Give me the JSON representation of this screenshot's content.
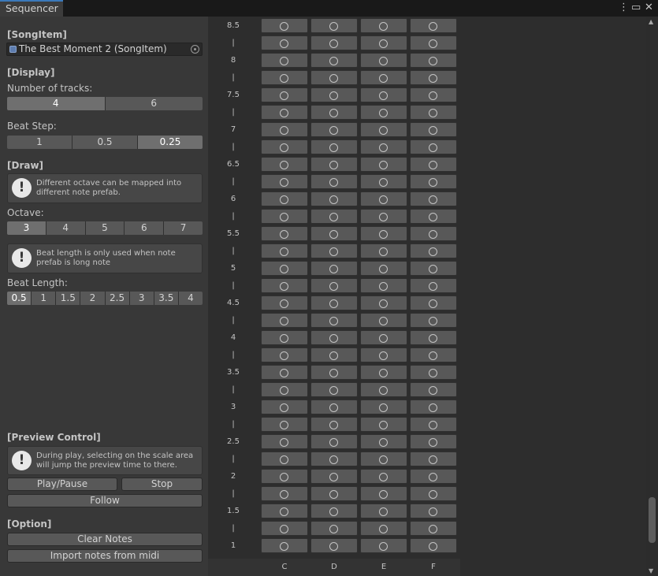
{
  "window": {
    "tab_title": "Sequencer",
    "menu_icon": "kebab-menu-icon",
    "maximize_icon": "maximize-icon",
    "close_icon": "close-icon"
  },
  "song_item": {
    "header": "[SongItem]",
    "value": "The Best Moment 2 (SongItem)"
  },
  "display": {
    "header": "[Display]",
    "tracks_label": "Number of tracks:",
    "tracks_options": [
      "4",
      "6"
    ],
    "tracks_selected": "4",
    "beat_step_label": "Beat Step:",
    "beat_step_options": [
      "1",
      "0.5",
      "0.25"
    ],
    "beat_step_selected": "0.25"
  },
  "draw": {
    "header": "[Draw]",
    "help_text": "Different octave can be mapped into different note prefab.",
    "octave_label": "Octave:",
    "octave_options": [
      "3",
      "4",
      "5",
      "6",
      "7"
    ],
    "octave_selected": "3",
    "help_text_2": "Beat length is only used when note prefab is long note",
    "beat_length_label": "Beat Length:",
    "beat_length_options": [
      "0.5",
      "1",
      "1.5",
      "2",
      "2.5",
      "3",
      "3.5",
      "4"
    ],
    "beat_length_selected": "0.5"
  },
  "preview": {
    "header": "[Preview Control]",
    "help_text": "During play, selecting on the scale area will jump the preview time to there.",
    "play_pause": "Play/Pause",
    "stop": "Stop",
    "follow": "Follow"
  },
  "option": {
    "header": "[Option]",
    "clear_notes": "Clear Notes",
    "import_midi": "Import notes from midi"
  },
  "sequencer": {
    "scale_labels": [
      "8.5",
      "|",
      "8",
      "|",
      "7.5",
      "|",
      "7",
      "|",
      "6.5",
      "|",
      "6",
      "|",
      "5.5",
      "|",
      "5",
      "|",
      "4.5",
      "|",
      "4",
      "|",
      "3.5",
      "|",
      "3",
      "|",
      "2.5",
      "|",
      "2",
      "|",
      "1.5",
      "|",
      "1"
    ],
    "columns": [
      "C",
      "D",
      "E",
      "F"
    ],
    "cell_icon": "empty-circle-icon",
    "colors": {
      "cell": "#585858",
      "panel": "#383838",
      "grid_bg": "#2d2d2d",
      "tab_accent": "#3a79bb"
    }
  }
}
